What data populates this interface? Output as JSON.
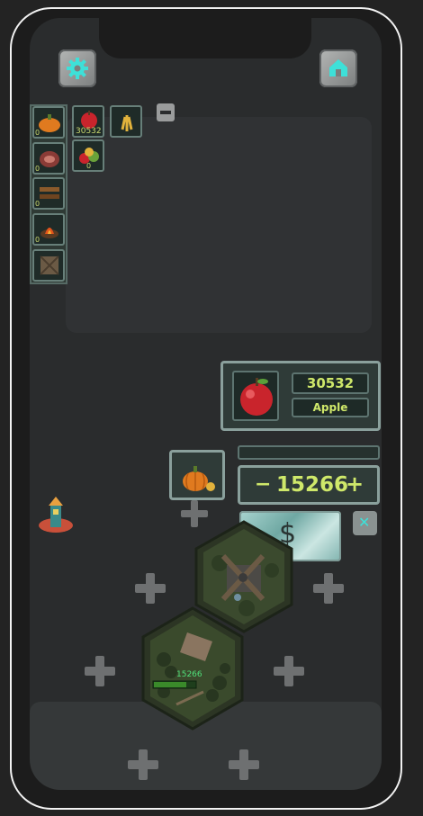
{
  "inventory": {
    "column": [
      {
        "icon": "pumpkin-icon",
        "count": "0"
      },
      {
        "icon": "meat-icon",
        "count": "0"
      },
      {
        "icon": "wood-planks-icon",
        "count": "0"
      },
      {
        "icon": "fire-pit-icon",
        "count": "0"
      },
      {
        "icon": "crate-icon",
        "count": ""
      }
    ],
    "row": [
      {
        "icon": "apple-icon",
        "count": "30532"
      },
      {
        "icon": "wheat-icon",
        "count": ""
      },
      {
        "icon": "vegetables-icon",
        "count": "0"
      }
    ]
  },
  "resource_panel": {
    "value": "30532",
    "name": "Apple"
  },
  "trade_panel": {
    "amount": "15266",
    "minus": "−",
    "plus": "+"
  },
  "sell_button": {
    "symbol": "$"
  },
  "tile_label": "15266",
  "close_symbol": "✕"
}
